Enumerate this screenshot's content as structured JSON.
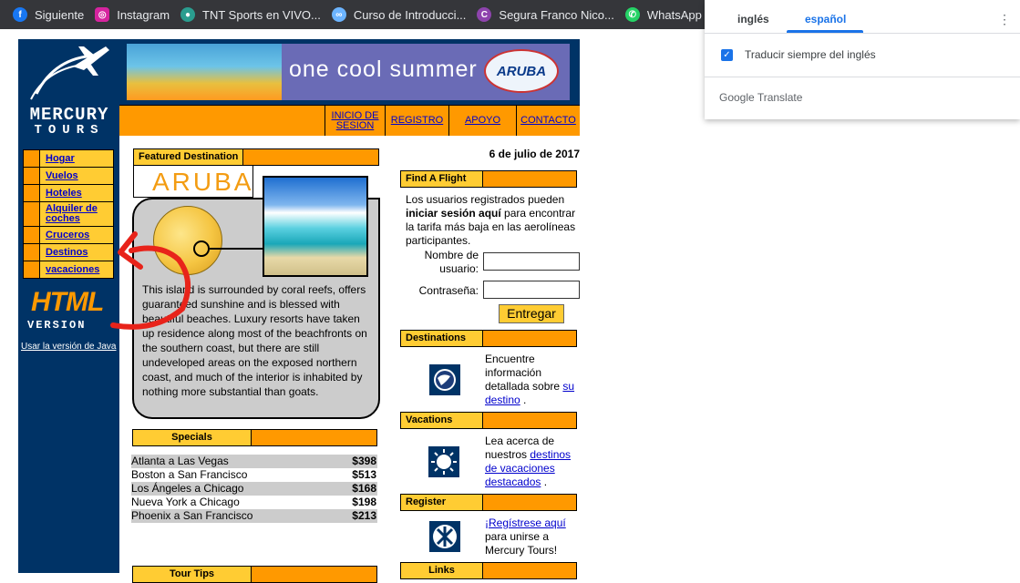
{
  "bookmarks": [
    {
      "label": "Siguiente",
      "icon": "facebook-icon",
      "color": "#1877f2"
    },
    {
      "label": "Instagram",
      "icon": "instagram-icon",
      "color": "#d6249f"
    },
    {
      "label": "TNT Sports en VIVO...",
      "icon": "tnt-icon",
      "color": "#2a9d8f"
    },
    {
      "label": "Curso de Introducci...",
      "icon": "course-icon",
      "color": "#6cb4ff"
    },
    {
      "label": "Segura Franco Nico...",
      "icon": "segura-icon",
      "color": "#8e44ad"
    },
    {
      "label": "WhatsApp",
      "icon": "whatsapp-icon",
      "color": "#25d366"
    },
    {
      "label": "",
      "icon": "discord-icon",
      "color": "#5865f2"
    }
  ],
  "logo": {
    "line1": "MERCURY",
    "line2": "TOURS"
  },
  "banner": {
    "text": "one cool summer",
    "logo": "ARUBA"
  },
  "topnav": [
    {
      "label": "INICIO DE SESION"
    },
    {
      "label": "REGISTRO"
    },
    {
      "label": "APOYO"
    },
    {
      "label": "CONTACTO"
    }
  ],
  "sidenav": [
    {
      "label": "Hogar"
    },
    {
      "label": "Vuelos"
    },
    {
      "label": "Hoteles"
    },
    {
      "label": "Alquiler de coches"
    },
    {
      "label": "Cruceros"
    },
    {
      "label": "Destinos"
    },
    {
      "label": "vacaciones"
    }
  ],
  "html_badge": {
    "big": "HTML",
    "small": "VERSION",
    "java_link": "Usar la versión de Java"
  },
  "featured": {
    "header": "Featured Destination",
    "word": "ARUBA",
    "text": "This island is surrounded by coral reefs, offers guaranteed sunshine and is blessed with beautiful beaches. Luxury resorts have taken up residence along most of the beachfronts on the southern coast, but there are still undeveloped areas on the exposed northern coast, and much of the interior is inhabited by nothing more substantial than goats."
  },
  "specials": {
    "header": "Specials",
    "rows": [
      {
        "route": "Atlanta a Las Vegas",
        "price": "$398"
      },
      {
        "route": "Boston a San Francisco",
        "price": "$513"
      },
      {
        "route": "Los Ángeles a Chicago",
        "price": "$168"
      },
      {
        "route": "Nueva York a Chicago",
        "price": "$198"
      },
      {
        "route": "Phoenix a San Francisco",
        "price": "$213"
      }
    ]
  },
  "tours_header": "Tour Tips",
  "date": "6 de julio de 2017",
  "find_flight": {
    "header": "Find A Flight",
    "text_pre": "Los usuarios registrados pueden ",
    "text_bold": "iniciar sesión aquí",
    "text_post": " para encontrar la tarifa más baja en las aerolíneas participantes.",
    "user_label": "Nombre de usuario:",
    "pass_label": "Contraseña:",
    "user_value": "",
    "pass_value": "",
    "submit": "Entregar"
  },
  "destinations": {
    "header": "Destinations",
    "text": "Encuentre información detallada sobre ",
    "link1": "su",
    "link2": "destino",
    "post": " ."
  },
  "vacations": {
    "header": "Vacations",
    "text": "Lea acerca de nuestros ",
    "link": "destinos de vacaciones destacados",
    "post": " ."
  },
  "register": {
    "header": "Register",
    "link": "¡Regístrese aquí",
    "text": " para unirse a Mercury Tours!"
  },
  "links_header": "Links",
  "translate": {
    "tab_source": "inglés",
    "tab_target": "español",
    "checkbox_label": "Traducir siempre del inglés",
    "checked": true,
    "brand": "Google Translate"
  },
  "colors": {
    "navy": "#003366",
    "orange": "#ff9900",
    "yellow": "#ffcc33",
    "link": "#0000cc",
    "annotation_red": "#e8231a"
  }
}
